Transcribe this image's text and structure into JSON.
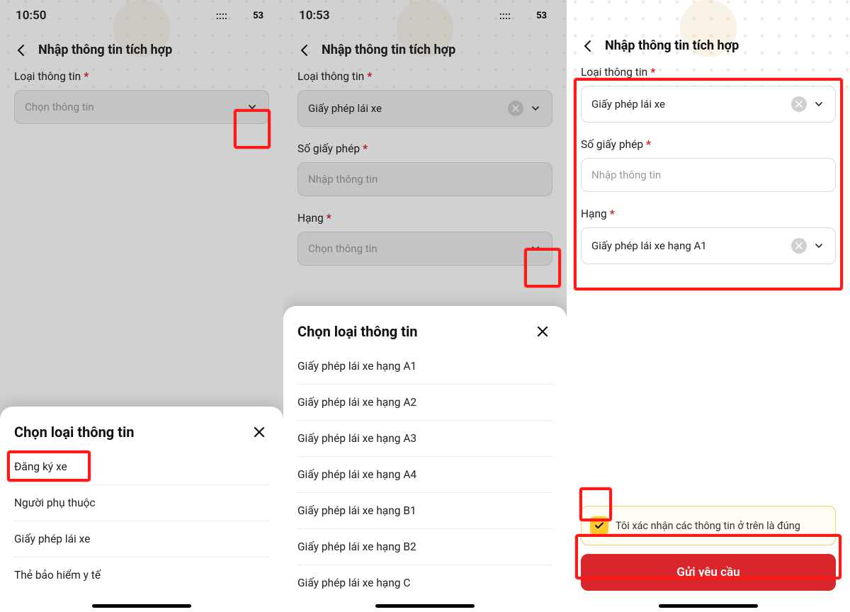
{
  "header_title": "Nhập thông tin tích hợp",
  "labels": {
    "info_type": "Loại thông tin",
    "license_no": "Số giấy phép",
    "rank": "Hạng"
  },
  "placeholders": {
    "choose_info": "Chọn thông tin",
    "enter_info": "Nhập thông tin"
  },
  "values": {
    "license_type": "Giấy phép lái xe",
    "rank_a1": "Giấy phép lái xe hạng A1"
  },
  "sheet1": {
    "title": "Chọn loại thông tin",
    "options": [
      "Đăng ký xe",
      "Người phụ thuộc",
      "Giấy phép lái xe",
      "Thẻ bảo hiểm y tế"
    ]
  },
  "sheet2": {
    "title": "Chọn loại thông tin",
    "options": [
      "Giấy phép lái xe hạng A1",
      "Giấy phép lái xe hạng A2",
      "Giấy phép lái xe hạng A3",
      "Giấy phép lái xe hạng A4",
      "Giấy phép lái xe hạng B1",
      "Giấy phép lái xe hạng B2",
      "Giấy phép lái xe hạng C"
    ]
  },
  "confirm_text": "Tôi xác nhận các thông tin ở trên là đúng",
  "submit_label": "Gửi yêu cầu",
  "status": {
    "t1": "10:50",
    "t2": "10:53",
    "battery": "53",
    "signal_glyph": "::::"
  }
}
